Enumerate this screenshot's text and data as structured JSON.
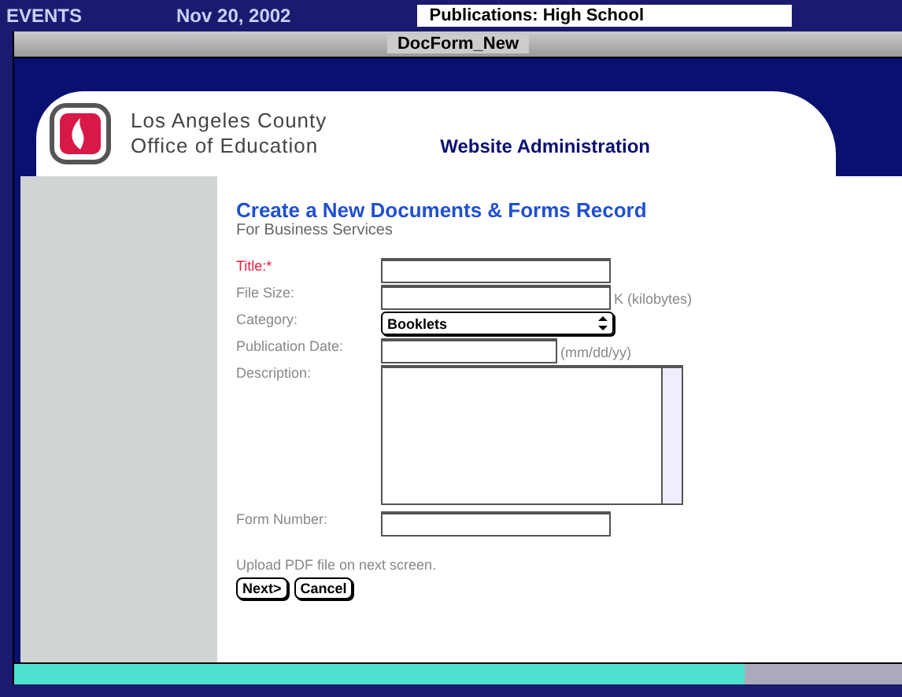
{
  "background_strip": {
    "texts": [
      "EVENTS",
      "Nov 20, 2002"
    ],
    "tab": "Publications: High School"
  },
  "window": {
    "title": "DocForm_New"
  },
  "header": {
    "org_line_1": "Los Angeles County",
    "org_line_2": "Office of Education",
    "section": "Website Administration"
  },
  "form": {
    "heading": "Create a New Documents & Forms Record",
    "subheading": "For Business Services",
    "fields": [
      {
        "kind": "text",
        "label": "Title:*",
        "required": true
      },
      {
        "kind": "text",
        "label": "File Size:",
        "hint": "K (kilobytes)",
        "required": false
      },
      {
        "kind": "select",
        "label": "Category:",
        "value": "Booklets",
        "required": false
      },
      {
        "kind": "date",
        "label": "Publication Date:",
        "hint": "(mm/dd/yy)",
        "required": false
      },
      {
        "kind": "textarea",
        "label": "Description:",
        "required": false
      },
      {
        "kind": "text",
        "label": "Form Number:",
        "required": false
      }
    ],
    "note": "Upload PDF file on next screen.",
    "buttons": [
      "Next>",
      "Cancel"
    ]
  }
}
